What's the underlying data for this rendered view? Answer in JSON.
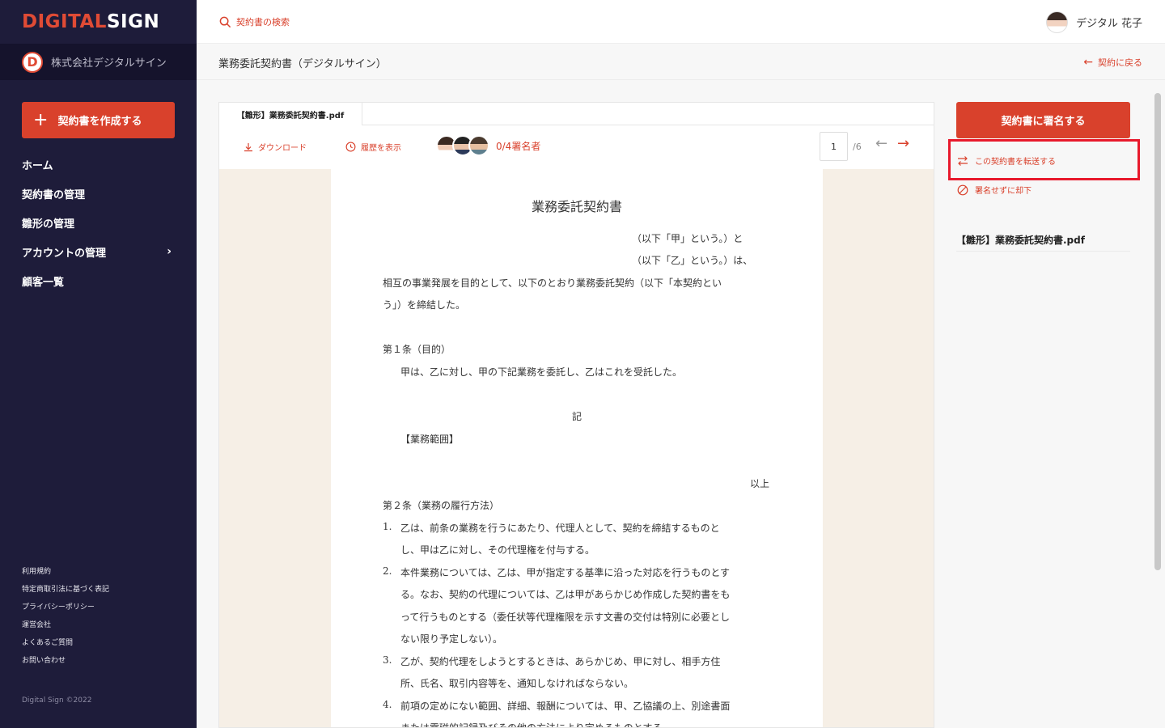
{
  "sidebar": {
    "logo_part1": "DIGITAL",
    "logo_part2": "SIGN",
    "company_badge": "D",
    "company_name": "株式会社デジタルサイン",
    "create_button": "契約書を作成する",
    "nav": [
      {
        "label": "ホーム"
      },
      {
        "label": "契約書の管理"
      },
      {
        "label": "雛形の管理"
      },
      {
        "label": "アカウントの管理"
      },
      {
        "label": "顧客一覧"
      }
    ],
    "footer_links": [
      "利用規約",
      "特定商取引法に基づく表記",
      "プライバシーポリシー",
      "運営会社",
      "よくあるご質問",
      "お問い合わせ"
    ],
    "copyright": "Digital Sign ©2022"
  },
  "header": {
    "search_label": "契約書の検索",
    "user_name": "デジタル 花子"
  },
  "subbar": {
    "title": "業務委託契約書（デジタルサイン）",
    "back_label": "契約に戻る"
  },
  "document": {
    "tab_label": "【雛形】業務委託契約書.pdf",
    "download_label": "ダウンロード",
    "history_label": "履歴を表示",
    "signers_count": "0/4署名者",
    "page_current": "1",
    "page_total": "/6",
    "content": {
      "title": "業務委託契約書",
      "line1": "（以下「甲」という。）と",
      "line2": "（以下「乙」という。）は、",
      "line3": "相互の事業発展を目的として、以下のとおり業務委託契約（以下「本契約とい",
      "line4": "う」）を締結した。",
      "art1": "第１条（目的）",
      "art1_body": "甲は、乙に対し、甲の下記業務を委託し、乙はこれを受託した。",
      "ki": "記",
      "scope": "【業務範囲】",
      "ijo": "以上",
      "art2": "第２条（業務の履行方法）",
      "n1": "1.",
      "p1a": "乙は、前条の業務を行うにあたり、代理人として、契約を締結するものと",
      "p1b": "し、甲は乙に対し、その代理権を付与する。",
      "n2": "2.",
      "p2a": "本件業務については、乙は、甲が指定する基準に沿った対応を行うものとす",
      "p2b": "る。なお、契約の代理については、乙は甲があらかじめ作成した契約書をも",
      "p2c": "って行うものとする（委任状等代理権限を示す文書の交付は特別に必要とし",
      "p2d": "ない限り予定しない）。",
      "n3": "3.",
      "p3a": "乙が、契約代理をしようとするときは、あらかじめ、甲に対し、相手方住",
      "p3b": "所、氏名、取引内容等を、通知しなければならない。",
      "n4": "4.",
      "p4a": "前項の定めにない範囲、詳細、報酬については、甲、乙協議の上、別途書面",
      "p4b": "または電磁的記録及びその他の方法により定めるものとする。"
    }
  },
  "right_panel": {
    "sign_button": "契約書に署名する",
    "forward_label": "この契約書を転送する",
    "reject_label": "署名せずに却下",
    "file_name": "【雛形】業務委託契約書.pdf"
  },
  "colors": {
    "accent": "#d9412c",
    "sidebar_bg": "#1e1c3a",
    "highlight": "#e8192c",
    "doc_bg": "#f6efe6"
  }
}
